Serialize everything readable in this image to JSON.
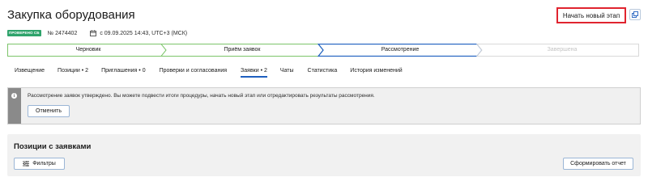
{
  "page": {
    "title": "Закупка оборудования"
  },
  "header_actions": {
    "new_stage_label": "Начать новый этап"
  },
  "meta": {
    "badge": "ПРОВЕРЕНО СБ",
    "number": "№ 2474402",
    "date": "с 09.09.2025 14:43, UTC+3 (МСК)"
  },
  "stepper": {
    "steps": [
      {
        "label": "Черновик",
        "state": "done"
      },
      {
        "label": "Приём заявок",
        "state": "done"
      },
      {
        "label": "Рассмотрение",
        "state": "current"
      },
      {
        "label": "Завершена",
        "state": "pending"
      }
    ]
  },
  "tabs": [
    {
      "label": "Извещение"
    },
    {
      "label": "Позиции • 2"
    },
    {
      "label": "Приглашения • 0"
    },
    {
      "label": "Проверки и согласования"
    },
    {
      "label": "Заявки • 2",
      "active": true
    },
    {
      "label": "Чаты"
    },
    {
      "label": "Статистика"
    },
    {
      "label": "История изменений"
    }
  ],
  "notice": {
    "text": "Рассмотрение заявок утверждено. Вы можете подвести итоги процедуры, начать новый этап или отредактировать результаты рассмотрения.",
    "cancel_label": "Отменить"
  },
  "positions": {
    "title": "Позиции с заявками",
    "filters_label": "Фильтры",
    "report_label": "Сформировать отчет"
  },
  "colors": {
    "done_step_border": "#7cc46a",
    "current_step_border": "#1e5fbf",
    "pending_step_border": "#d9d9d9",
    "highlight_border": "#e0242f",
    "badge_green": "#2ea36b"
  }
}
